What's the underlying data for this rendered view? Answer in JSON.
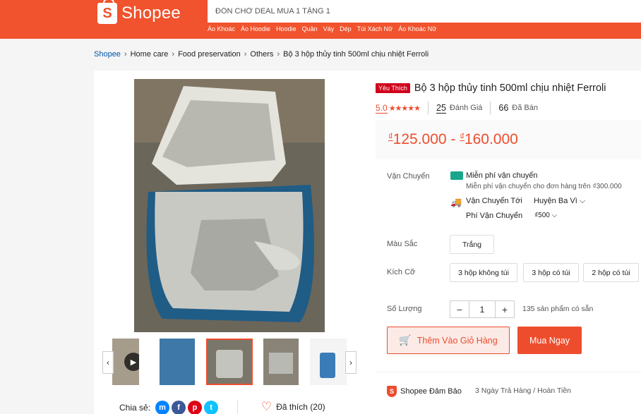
{
  "header": {
    "logo_text": "Shopee",
    "logo_letter": "S",
    "search_placeholder": "ĐÓN CHỜ DEAL MUA 1 TẶNG 1",
    "hot_keywords": [
      "Áo Khoác",
      "Áo Hoodie",
      "Hoodie",
      "Quần",
      "Váy",
      "Dép",
      "Túi Xách Nữ",
      "Áo Khoác Nữ"
    ]
  },
  "breadcrumb": [
    "Shopee",
    "Home care",
    "Food preservation",
    "Others",
    "Bộ 3 hộp thủy tinh 500ml chịu nhiệt Ferroli"
  ],
  "product": {
    "badge": "Yêu Thích",
    "title": "Bộ 3 hộp thủy tinh 500ml chịu nhiệt Ferroli",
    "rating": "5.0",
    "stars": "★★★★★",
    "reviews_count": "25",
    "reviews_label": "Đánh Giá",
    "sold_count": "66",
    "sold_label": "Đã Bán",
    "currency": "₫",
    "price_min": "125.000",
    "price_sep": " - ",
    "price_max": "160.000"
  },
  "shipping": {
    "label": "Vận Chuyển",
    "free_title": "Miễn phí vận chuyển",
    "free_desc": "Miễn phí vận chuyển cho đơn hàng trên ₫300.000",
    "to_label": "Vận Chuyển Tới",
    "to_value": "Huyện Ba Vì",
    "fee_label": "Phí Vận Chuyển",
    "fee_value": "₫500"
  },
  "color": {
    "label": "Màu Sắc",
    "options": [
      "Trắng"
    ]
  },
  "size": {
    "label": "Kích Cỡ",
    "options": [
      "3 hộp không túi",
      "3 hộp có túi",
      "2 hộp có túi"
    ]
  },
  "quantity": {
    "label": "Số Lượng",
    "minus": "−",
    "value": "1",
    "plus": "+",
    "stock": "135 sản phẩm có sẵn"
  },
  "actions": {
    "add_to_cart": "Thêm Vào Giỏ Hàng",
    "buy_now": "Mua Ngay"
  },
  "guarantee": {
    "title": "Shopee Đảm Bảo",
    "desc": "3 Ngày Trả Hàng / Hoàn Tiền"
  },
  "social": {
    "share_label": "Chia sẻ:",
    "like_label": "Đã thích (20)"
  },
  "colors": {
    "brand": "#f0532d",
    "accent": "#ee4d2d"
  }
}
